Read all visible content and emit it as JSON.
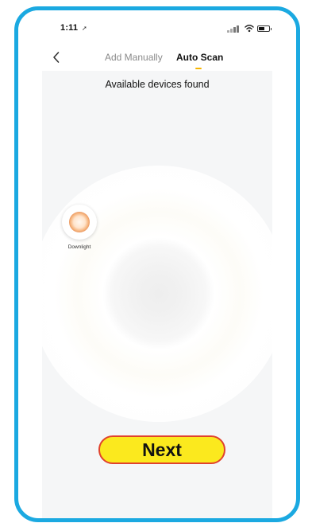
{
  "status_bar": {
    "time": "1:11",
    "location_icon": "location-arrow-icon",
    "signal_icon": "cellular-signal-icon",
    "wifi_icon": "wifi-icon",
    "battery_icon": "battery-icon"
  },
  "nav": {
    "back_icon": "chevron-left-icon",
    "tabs": [
      {
        "label": "Add Manually",
        "selected": false
      },
      {
        "label": "Auto Scan",
        "selected": true
      }
    ]
  },
  "scan": {
    "status_text": "Available devices found",
    "devices": [
      {
        "name": "Downlight",
        "icon": "downlight-icon"
      }
    ]
  },
  "actions": {
    "next_label": "Next"
  },
  "colors": {
    "frame_border": "#1ba9e1",
    "tab_indicator": "#f7b500",
    "next_fill": "#fbe91e",
    "next_border": "#e0422d"
  }
}
